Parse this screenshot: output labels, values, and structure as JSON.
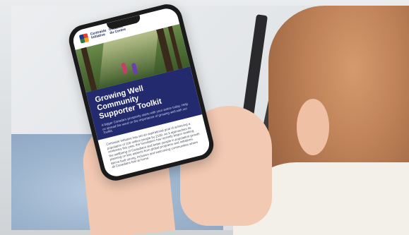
{
  "phone_screen": {
    "logo": {
      "left_line1": "Centraide",
      "left_line2": "Initiative",
      "right_line1": "Initiative",
      "right_line2": "du Centre"
    },
    "headline": {
      "line1": "Growing Well",
      "line2": "Community",
      "line3": "Supporter Toolkit"
    },
    "intro_text": "A bigger Canada's prosperity starts with your action today. Help us spread the word on the importance of growing well with our Toolkit.",
    "body_text": "Centraide Initiative has set an aspirational goal of achieving a population of 100 million people by 2100. As it approaches its centenary this year, the foundation has recently begun seeking the wellbeing of Canadians and better people in population growth planning on key aspects from global programs and initiatives. We've built strong, inclusive and welcoming communities where all Canadians feel at home."
  }
}
